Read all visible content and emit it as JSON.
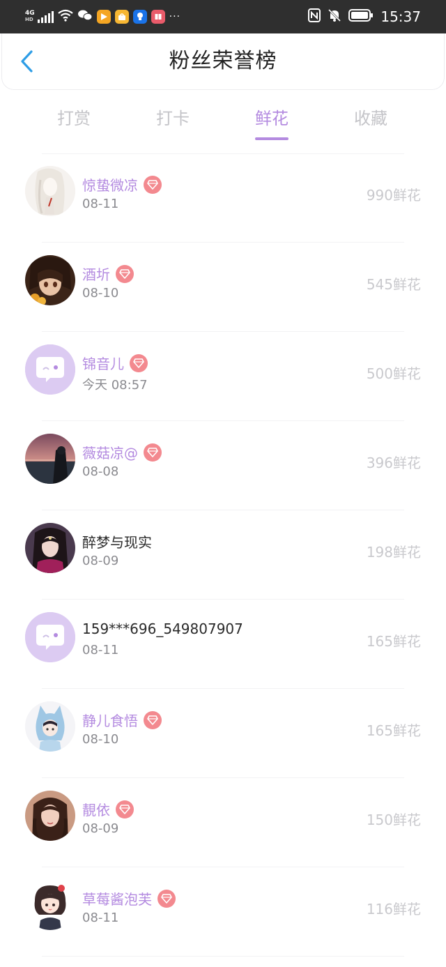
{
  "status_bar": {
    "network": "4G",
    "network_sub": "HD",
    "dots": "···",
    "time": "15:37",
    "icons": [
      "signal-icon",
      "wifi-icon",
      "wechat-icon",
      "video-app-icon",
      "shop-app-icon",
      "bulb-app-icon",
      "book-app-icon",
      "nfc-icon",
      "bell-off-icon",
      "battery-icon"
    ]
  },
  "header": {
    "title": "粉丝荣誉榜",
    "back_icon": "chevron-left-icon"
  },
  "tabs": [
    {
      "label": "打赏",
      "active": false
    },
    {
      "label": "打卡",
      "active": false
    },
    {
      "label": "鲜花",
      "active": true
    },
    {
      "label": "收藏",
      "active": false
    }
  ],
  "colors": {
    "accent": "#b48be0",
    "vip_badge": "#f3898f",
    "muted": "#c9c9cd",
    "date": "#8a8a8f"
  },
  "fans": [
    {
      "name": "惊蛰微凉",
      "date": "08-11",
      "amount": "990鲜花",
      "vip": true,
      "avatar": "anime-girl-avatar"
    },
    {
      "name": "酒圻",
      "date": "08-10",
      "amount": "545鲜花",
      "vip": true,
      "avatar": "anime-boy-avatar"
    },
    {
      "name": "锦音儿",
      "date": "今天 08:57",
      "amount": "500鲜花",
      "vip": true,
      "avatar": "default-chat-avatar"
    },
    {
      "name": "薇菇凉@",
      "date": "08-08",
      "amount": "396鲜花",
      "vip": true,
      "avatar": "sunset-avatar"
    },
    {
      "name": "醉梦与现实",
      "date": "08-09",
      "amount": "198鲜花",
      "vip": false,
      "avatar": "costume-girl-avatar"
    },
    {
      "name": "159***696_549807907",
      "date": "08-11",
      "amount": "165鲜花",
      "vip": false,
      "avatar": "default-chat-avatar"
    },
    {
      "name": "静儿食悟",
      "date": "08-10",
      "amount": "165鲜花",
      "vip": true,
      "avatar": "cat-hood-avatar"
    },
    {
      "name": "靚依",
      "date": "08-09",
      "amount": "150鲜花",
      "vip": true,
      "avatar": "girl-photo-avatar"
    },
    {
      "name": "草莓酱泡芙",
      "date": "08-11",
      "amount": "116鲜花",
      "vip": true,
      "avatar": "cartoon-girl-avatar"
    }
  ]
}
